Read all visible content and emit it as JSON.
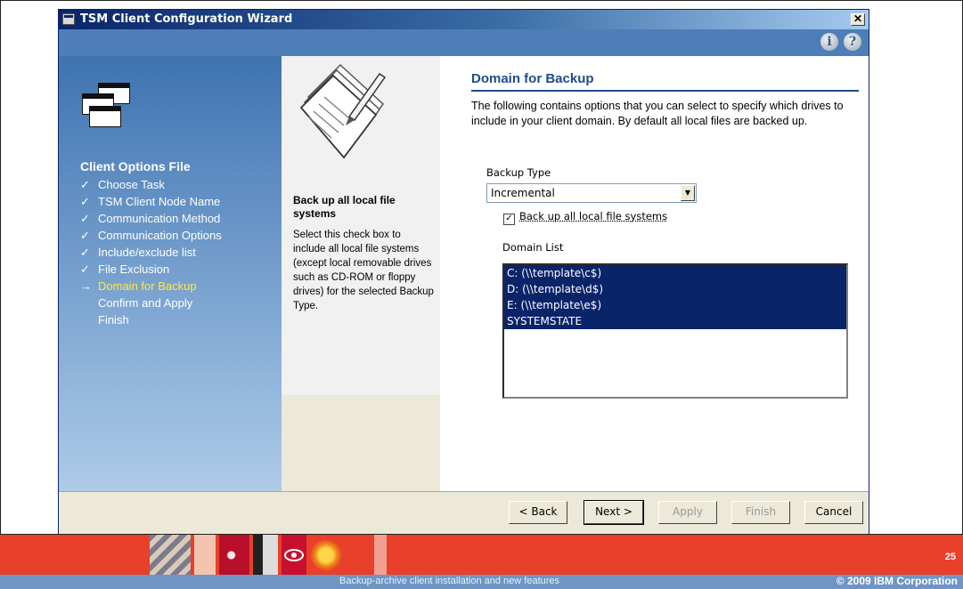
{
  "window": {
    "title": "TSM Client Configuration Wizard",
    "close_glyph": "✕"
  },
  "header": {
    "info_glyph": "i",
    "help_glyph": "?"
  },
  "steps": {
    "title": "Client Options File",
    "items": [
      {
        "label": "Choose Task",
        "mark": "✓"
      },
      {
        "label": "TSM Client Node Name",
        "mark": "✓"
      },
      {
        "label": "Communication Method",
        "mark": "✓"
      },
      {
        "label": "Communication Options",
        "mark": "✓"
      },
      {
        "label": "Include/exclude list",
        "mark": "✓"
      },
      {
        "label": "File Exclusion",
        "mark": "✓"
      },
      {
        "label": "Domain for Backup",
        "mark": "→"
      },
      {
        "label": "Confirm and Apply",
        "mark": ""
      },
      {
        "label": "Finish",
        "mark": ""
      }
    ]
  },
  "help": {
    "title": "Back up all local file systems",
    "body": "Select this check box to include all local file systems (except local removable drives such as CD-ROM or floppy drives) for the selected Backup Type."
  },
  "main": {
    "title": "Domain for Backup",
    "intro": "The following contains options that you can select to specify which drives to include in your client domain. By default all local files are backed up.",
    "backup_type_label": "Backup Type",
    "backup_type_value": "Incremental",
    "checkbox_label": "Back up all local file systems",
    "checkbox_mark": "✓",
    "domain_list_label": "Domain List",
    "domain_items": [
      "C: (\\\\template\\c$)",
      "D: (\\\\template\\d$)",
      "E: (\\\\template\\e$)",
      "SYSTEMSTATE"
    ]
  },
  "buttons": {
    "back": "< Back",
    "next": "Next >",
    "apply": "Apply",
    "finish": "Finish",
    "cancel": "Cancel"
  },
  "footer": {
    "text": "Backup-archive client installation and new features",
    "copyright": "© 2009 IBM Corporation",
    "slide_number": "25"
  },
  "colors": {
    "selection": "#0a246a",
    "title_blue": "#1f4d8c",
    "footer_red": "#e8402a",
    "footer_blue": "#6e95c4"
  }
}
